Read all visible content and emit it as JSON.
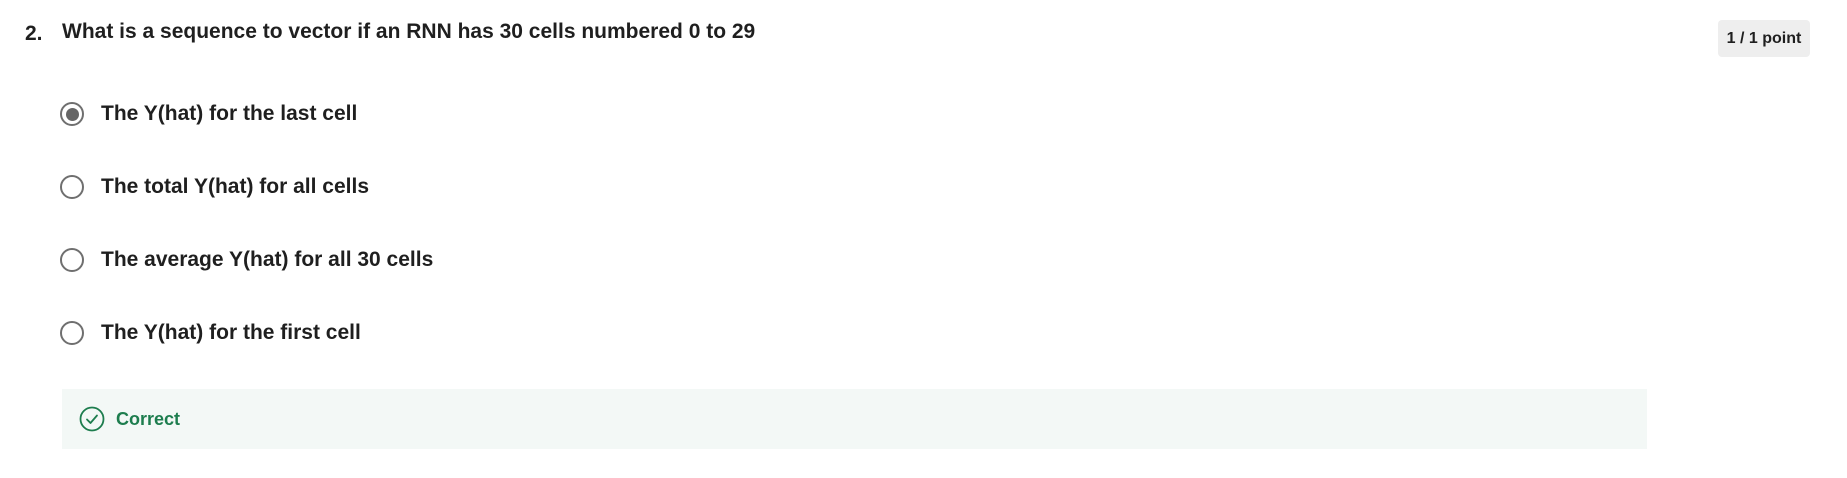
{
  "question": {
    "number": "2.",
    "text": "What is a sequence to vector if an RNN has 30 cells numbered 0 to 29",
    "score": "1 / 1 point"
  },
  "options": [
    {
      "label": "The Y(hat) for the last cell",
      "selected": true
    },
    {
      "label": "The total Y(hat) for all cells",
      "selected": false
    },
    {
      "label": "The average Y(hat) for all 30 cells",
      "selected": false
    },
    {
      "label": "The Y(hat) for the first cell",
      "selected": false
    }
  ],
  "feedback": {
    "icon": "check-circle-icon",
    "label": "Correct",
    "color": "#1d7d4e",
    "background": "#f3f8f6"
  }
}
